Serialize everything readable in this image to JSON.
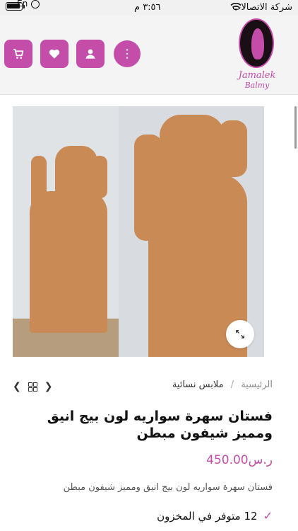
{
  "status_bar": {
    "carrier": "شركة الاتصالات",
    "time": "٣:٥٦ م",
    "keyboard_language": "En"
  },
  "header": {
    "brand_line1": "Jamalek",
    "brand_line2": "Balmy",
    "accent_color": "#c44daa",
    "icons": [
      "menu-icon",
      "user-icon",
      "heart-icon",
      "cart-icon"
    ]
  },
  "gallery": {
    "zoom_icon": "expand-icon"
  },
  "breadcrumb": {
    "home": "الرئيسية",
    "separator": "/",
    "category": "ملابس نسائية"
  },
  "product": {
    "title": "فستان سهرة سواريه لون بيج انيق ومميز شيفون مبطن",
    "price": "ر.س450.00",
    "short_description": "فستان سهرة سواريه لون بيج انيق ومميز شيفون مبطن",
    "stock": "12 متوفر في المخزون"
  }
}
